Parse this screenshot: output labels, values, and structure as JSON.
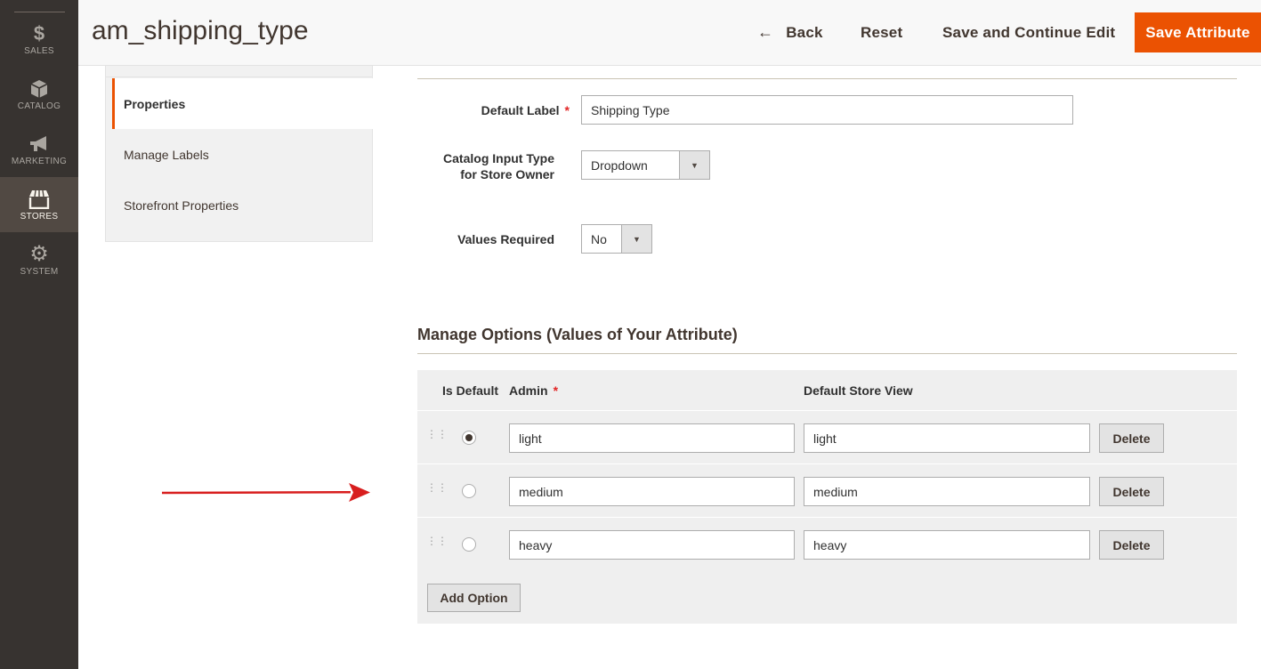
{
  "sidebar": {
    "items": [
      {
        "icon": "dollar-icon",
        "glyph": "$",
        "label": "SALES"
      },
      {
        "icon": "catalog-box-icon",
        "glyph": "◆",
        "label": "CATALOG"
      },
      {
        "icon": "megaphone-icon",
        "glyph": "◣",
        "label": "MARKETING"
      },
      {
        "icon": "store-icon",
        "glyph": "⌂",
        "label": "STORES"
      },
      {
        "icon": "gear-icon",
        "glyph": "⚙",
        "label": "SYSTEM"
      }
    ]
  },
  "header": {
    "title": "am_shipping_type",
    "back_label": "Back",
    "reset_label": "Reset",
    "save_continue_label": "Save and Continue Edit",
    "save_label": "Save Attribute"
  },
  "tabs": {
    "items": [
      {
        "label": "Properties"
      },
      {
        "label": "Manage Labels"
      },
      {
        "label": "Storefront Properties"
      }
    ]
  },
  "form": {
    "default_label": {
      "label": "Default Label",
      "required_mark": "*",
      "value": "Shipping Type"
    },
    "input_type": {
      "label": "Catalog Input Type for Store Owner",
      "value": "Dropdown"
    },
    "values_required": {
      "label": "Values Required",
      "value": "No"
    }
  },
  "options": {
    "title": "Manage Options (Values of Your Attribute)",
    "headers": {
      "is_default": "Is Default",
      "admin": "Admin",
      "admin_required": "*",
      "store_view": "Default Store View"
    },
    "rows": [
      {
        "admin": "light",
        "store_view": "light",
        "is_default": true,
        "delete_label": "Delete"
      },
      {
        "admin": "medium",
        "store_view": "medium",
        "is_default": false,
        "delete_label": "Delete"
      },
      {
        "admin": "heavy",
        "store_view": "heavy",
        "is_default": false,
        "delete_label": "Delete"
      }
    ],
    "add_label": "Add Option"
  },
  "colors": {
    "accent": "#eb5202",
    "sidebar_bg": "#373330",
    "annotation_arrow": "#d81e1e"
  }
}
